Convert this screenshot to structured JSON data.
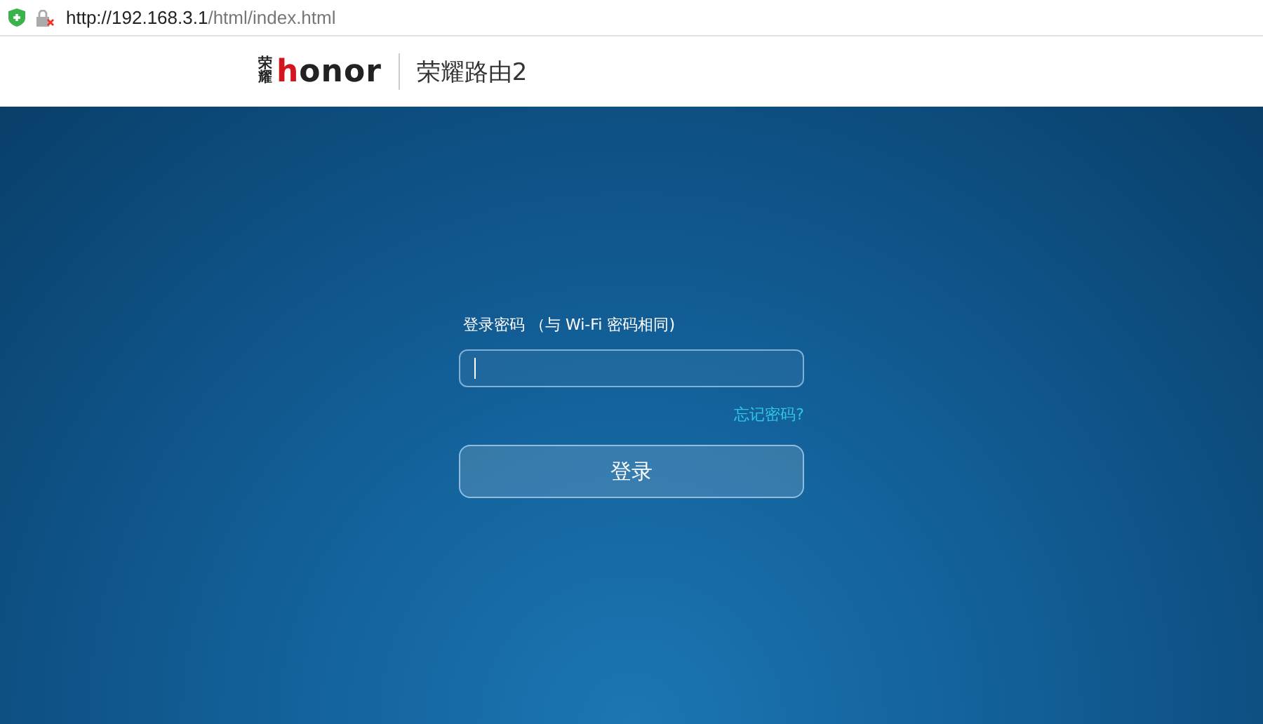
{
  "address_bar": {
    "url_host": "http://192.168.3.1",
    "url_path": "/html/index.html"
  },
  "header": {
    "logo_mark": "荣耀",
    "logo_word": "honor",
    "product": "荣耀路由2"
  },
  "login": {
    "label": "登录密码 （与 Wi-Fi 密码相同)",
    "forgot_link": "忘记密码?",
    "login_button": "登录"
  }
}
